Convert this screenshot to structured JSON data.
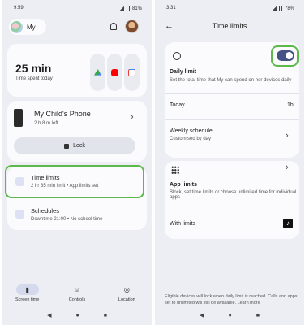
{
  "left": {
    "status_time": "9:59",
    "status_battery": "81%",
    "profile_name": "My",
    "summary": {
      "time": "25 min",
      "label": "Time spent today"
    },
    "apps": [
      {
        "icon": "drive-icon",
        "color": "#34a853"
      },
      {
        "icon": "youtube-icon",
        "color": "#ff0000"
      },
      {
        "icon": "gmail-icon",
        "color": "#ea4335"
      }
    ],
    "device": {
      "name": "My Child's Phone",
      "time_left": "2 h 8 m left",
      "lock_label": "Lock"
    },
    "time_limits": {
      "title": "Time limits",
      "subtitle": "2 hr 35 min limit • App limits set"
    },
    "schedules": {
      "title": "Schedules",
      "subtitle": "Downtime 21:00 • No school time"
    },
    "nav": [
      {
        "label": "Screen time",
        "icon": "bar-chart-icon",
        "active": true
      },
      {
        "label": "Controls",
        "icon": "controls-icon",
        "active": false
      },
      {
        "label": "Location",
        "icon": "location-icon",
        "active": false
      }
    ]
  },
  "right": {
    "status_time": "3:31",
    "status_battery": "78%",
    "title": "Time limits",
    "daily_limit": {
      "title": "Daily limit",
      "description": "Set the total time that My can spend on her devices daily",
      "enabled": true,
      "today_label": "Today",
      "today_value": "1h",
      "weekly_title": "Weekly schedule",
      "weekly_sub": "Customised by day"
    },
    "app_limits": {
      "title": "App limits",
      "description": "Block, set time limits or choose unlimited time for individual apps",
      "with_limits": "With limits"
    },
    "footnote": "Eligible devices will lock when daily limit is reached. Calls and apps set to unlimited will still be available. Learn more"
  },
  "colors": {
    "highlight": "#5db94b",
    "toggle": "#465286",
    "background": "#edeef4"
  }
}
